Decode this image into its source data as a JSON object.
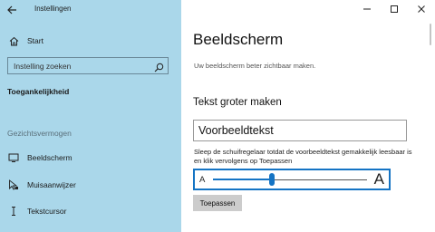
{
  "app": {
    "title": "Instellingen"
  },
  "sidebar": {
    "home_label": "Start",
    "search_placeholder": "Instelling zoeken",
    "section_heading": "Toegankelijkheid",
    "group_label": "Gezichtsvermogen",
    "items": [
      {
        "label": "Beeldscherm",
        "icon": "display-icon"
      },
      {
        "label": "Muisaanwijzer",
        "icon": "mouse-pointer-icon"
      },
      {
        "label": "Tekstcursor",
        "icon": "text-cursor-icon"
      }
    ]
  },
  "main": {
    "title": "Beeldscherm",
    "subtitle": "Uw beeldscherm beter zichtbaar maken.",
    "section_title": "Tekst groter maken",
    "sample_text": "Voorbeeldtekst",
    "instruction": "Sleep de schuifregelaar totdat de voorbeeldtekst gemakkelijk leesbaar is en klik vervolgens op Toepassen",
    "slider": {
      "min_label": "A",
      "max_label": "A",
      "value_fraction": 0.38
    },
    "apply_label": "Toepassen"
  },
  "window_controls": [
    "minimize-icon",
    "maximize-icon",
    "close-icon"
  ],
  "colors": {
    "sidebar_bg": "#aad7ea",
    "accent": "#1574c4",
    "button_bg": "#cccccc"
  }
}
